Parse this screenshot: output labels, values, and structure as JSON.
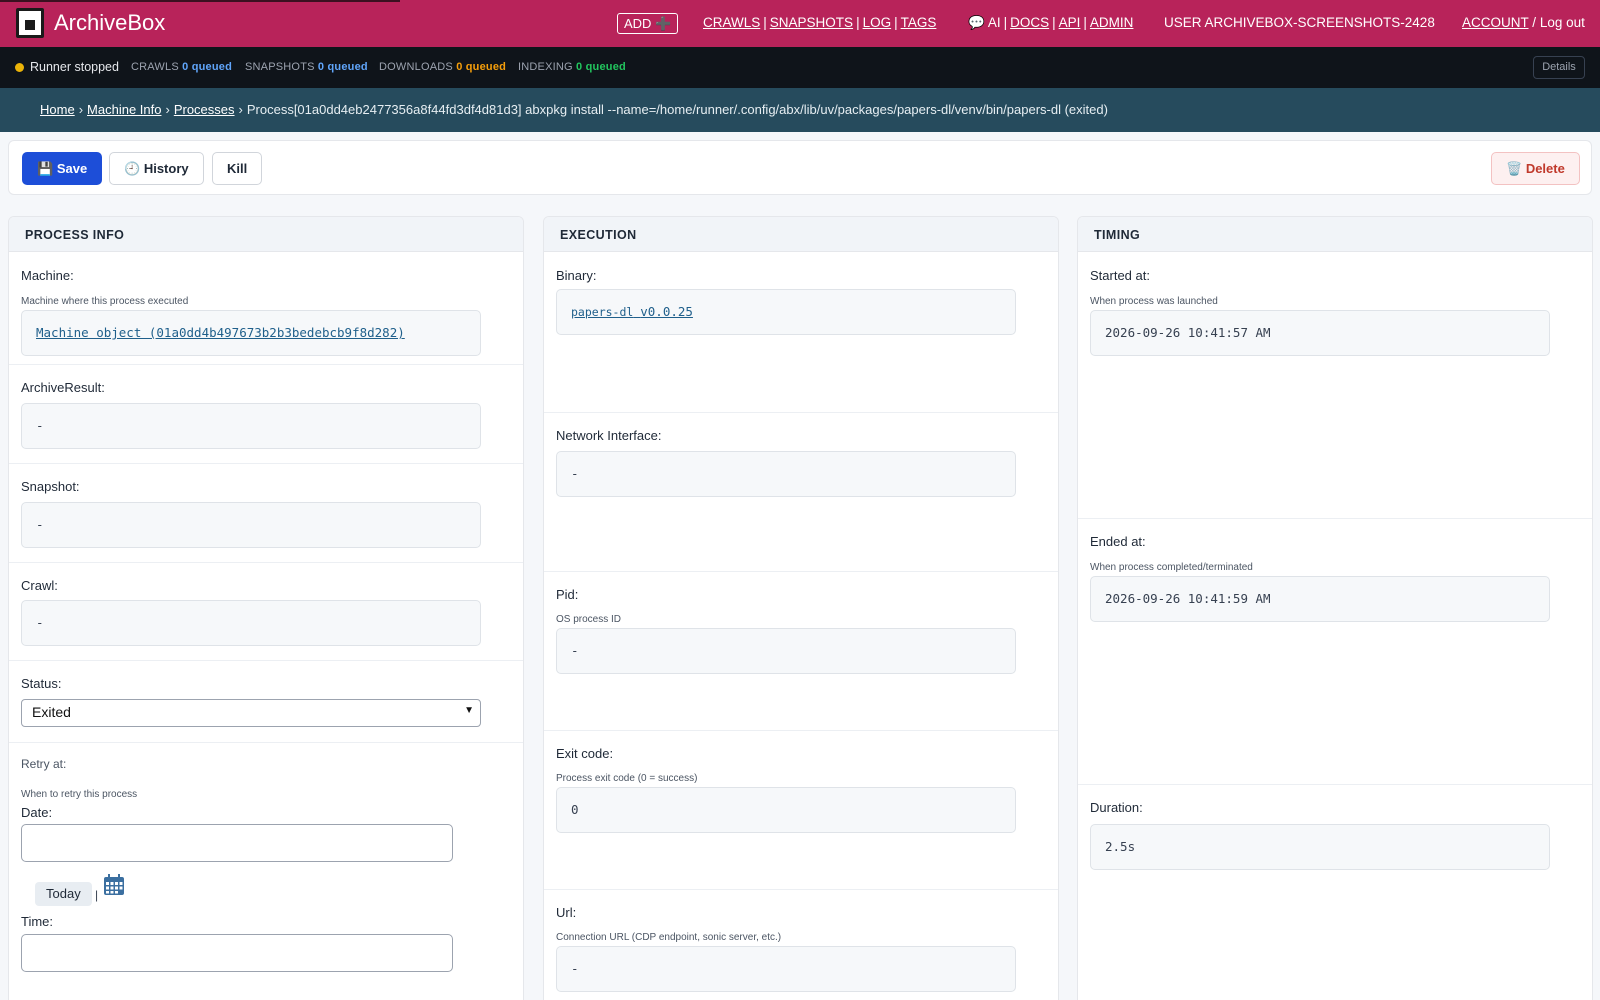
{
  "header": {
    "brand": "ArchiveBox",
    "add_label": "ADD",
    "add_icon": "➕",
    "nav_main": [
      "CRAWLS",
      "SNAPSHOTS",
      "LOG",
      "TAGS"
    ],
    "nav_help_icon": "💬",
    "nav_help": [
      "AI",
      "DOCS",
      "API",
      "ADMIN"
    ],
    "user_label": "USER ARCHIVEBOX-SCREENSHOTS-2428",
    "account_label": "ACCOUNT",
    "slash": "/",
    "logout_label": "Log out",
    "sep": "|"
  },
  "statusbar": {
    "runner": "Runner stopped",
    "stats": [
      {
        "label": "CRAWLS",
        "value": "0 queued",
        "color": "#60a5fa"
      },
      {
        "label": "SNAPSHOTS",
        "value": "0 queued",
        "color": "#60a5fa"
      },
      {
        "label": "DOWNLOADS",
        "value": "0 queued",
        "color": "#f59e0b"
      },
      {
        "label": "INDEXING",
        "value": "0 queued",
        "color": "#22c55e"
      }
    ],
    "details_label": "Details"
  },
  "breadcrumb": {
    "home": "Home",
    "machine_info": "Machine Info",
    "processes": "Processes",
    "arrow": "›",
    "current": "Process[01a0dd4eb2477356a8f44fd3df4d81d3] abxpkg install --name=/home/runner/.config/abx/lib/uv/packages/papers-dl/venv/bin/papers-dl (exited)"
  },
  "toolbar": {
    "save_icon": "💾",
    "save_label": "Save",
    "history_icon": "🕘",
    "history_label": "History",
    "kill_label": "Kill",
    "delete_icon": "🗑️",
    "delete_label": "Delete"
  },
  "process_info": {
    "title": "PROCESS INFO",
    "machine_label": "Machine:",
    "machine_help": "Machine where this process executed",
    "machine_value": "Machine object (01a0dd4b497673b2b3bedebcb9f8d282)",
    "archiveresult_label": "ArchiveResult:",
    "archiveresult_value": "-",
    "snapshot_label": "Snapshot:",
    "snapshot_value": "-",
    "crawl_label": "Crawl:",
    "crawl_value": "-",
    "status_label": "Status:",
    "status_value": "Exited",
    "retry_label": "Retry at:",
    "retry_help": "When to retry this process",
    "date_label": "Date:",
    "date_value": "",
    "today_label": "Today",
    "pipe": "|",
    "time_label": "Time:",
    "time_value": ""
  },
  "execution": {
    "title": "EXECUTION",
    "binary_label": "Binary:",
    "binary_name": "papers-dl",
    "binary_version": "v0.0.25",
    "network_label": "Network Interface:",
    "network_value": "-",
    "pid_label": "Pid:",
    "pid_help": "OS process ID",
    "pid_value": "-",
    "exit_label": "Exit code:",
    "exit_help": "Process exit code (0 = success)",
    "exit_value": "0",
    "url_label": "Url:",
    "url_help": "Connection URL (CDP endpoint, sonic server, etc.)",
    "url_value": "-"
  },
  "timing": {
    "title": "TIMING",
    "started_label": "Started at:",
    "started_help": "When process was launched",
    "started_value": "2026-09-26 10:41:57 AM",
    "ended_label": "Ended at:",
    "ended_help": "When process completed/terminated",
    "ended_value": "2026-09-26 10:41:59 AM",
    "duration_label": "Duration:",
    "duration_value": "2.5s"
  }
}
